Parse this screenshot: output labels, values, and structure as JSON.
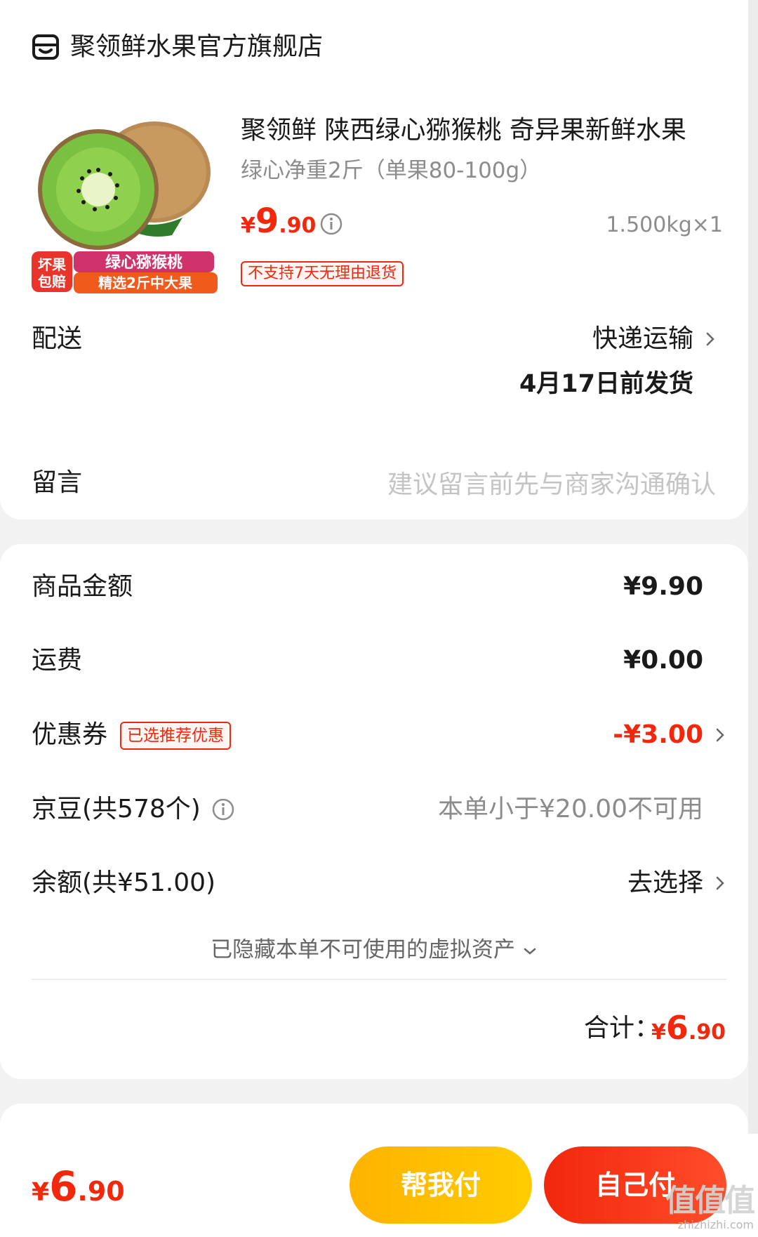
{
  "shop": {
    "name": "聚领鲜水果官方旗舰店"
  },
  "product": {
    "title": "聚领鲜 陕西绿心猕猴桃 奇异果新鲜水果",
    "spec": "绿心净重2斤（单果80-100g）",
    "price_symbol": "¥",
    "price_int": "9",
    "price_dec": ".90",
    "quantity": "1.500kg×1",
    "return_policy": "不支持7天无理由退货",
    "image_badge": {
      "left_line1": "坏果",
      "left_line2": "包赔",
      "right_line1": "绿心猕猴桃",
      "right_line2": "精选2斤中大果"
    }
  },
  "delivery": {
    "label": "配送",
    "method": "快递运输",
    "ship_date": "4月17日前发货"
  },
  "message": {
    "label": "留言",
    "placeholder": "建议留言前先与商家沟通确认",
    "value": ""
  },
  "summary": {
    "goods_amount": {
      "label": "商品金额",
      "value": "¥9.90"
    },
    "shipping": {
      "label": "运费",
      "value": "¥0.00"
    },
    "coupon": {
      "label": "优惠券",
      "tag": "已选推荐优惠",
      "value": "-¥3.00"
    },
    "jingdou": {
      "label": "京豆(共578个)",
      "value": "本单小于¥20.00不可用"
    },
    "balance": {
      "label": "余额(共¥51.00)",
      "value": "去选择"
    },
    "hidden_assets": "已隐藏本单不可使用的虚拟资产",
    "total_label": "合计：",
    "total_symbol": "¥",
    "total_int": "6",
    "total_dec": ".90"
  },
  "bottom_bar": {
    "price_symbol": "¥",
    "price_int": "6",
    "price_dec": ".90",
    "help_pay_button": "帮我付",
    "self_pay_button": "自己付"
  },
  "watermark": {
    "text": "值值值",
    "url": "zhizhizhi.com"
  },
  "colors": {
    "accent_red": "#f2270c",
    "help_pay_yellow": "#ffc107",
    "background": "#f2f2f2"
  },
  "icons": [
    "shop-icon",
    "info-icon",
    "chevron-right-icon",
    "chevron-down-icon"
  ]
}
